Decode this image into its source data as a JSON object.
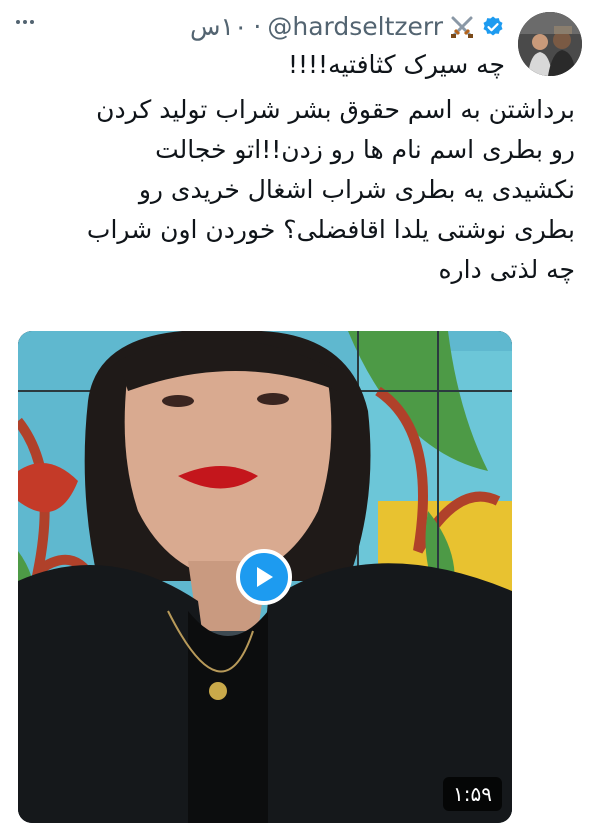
{
  "tweet": {
    "display_name_icons": "⚔️",
    "handle": "@hardseltzerr",
    "separator": "·",
    "time": "۱۰س",
    "verified": true,
    "first_line": "چه سیرک کثافتیه!!!!",
    "body_lines": [
      "برداشتن به اسم حقوق بشر شراب تولید کردن",
      "رو بطری اسم نام ها رو زدن!!اتو خجالت",
      "نکشیدی یه بطری شراب اشغال خریدی رو",
      "بطری نوشتی یلدا اقافضلی؟ خوردن اون شراب",
      "چه لذتی داره"
    ]
  },
  "video": {
    "duration": "۱:۵۹"
  },
  "icons": {
    "menu": "more-dots-icon",
    "verified": "verified-badge-icon",
    "play": "play-icon"
  },
  "colors": {
    "accent": "#1d9bf0",
    "text": "#0f1419",
    "muted": "#536471"
  }
}
